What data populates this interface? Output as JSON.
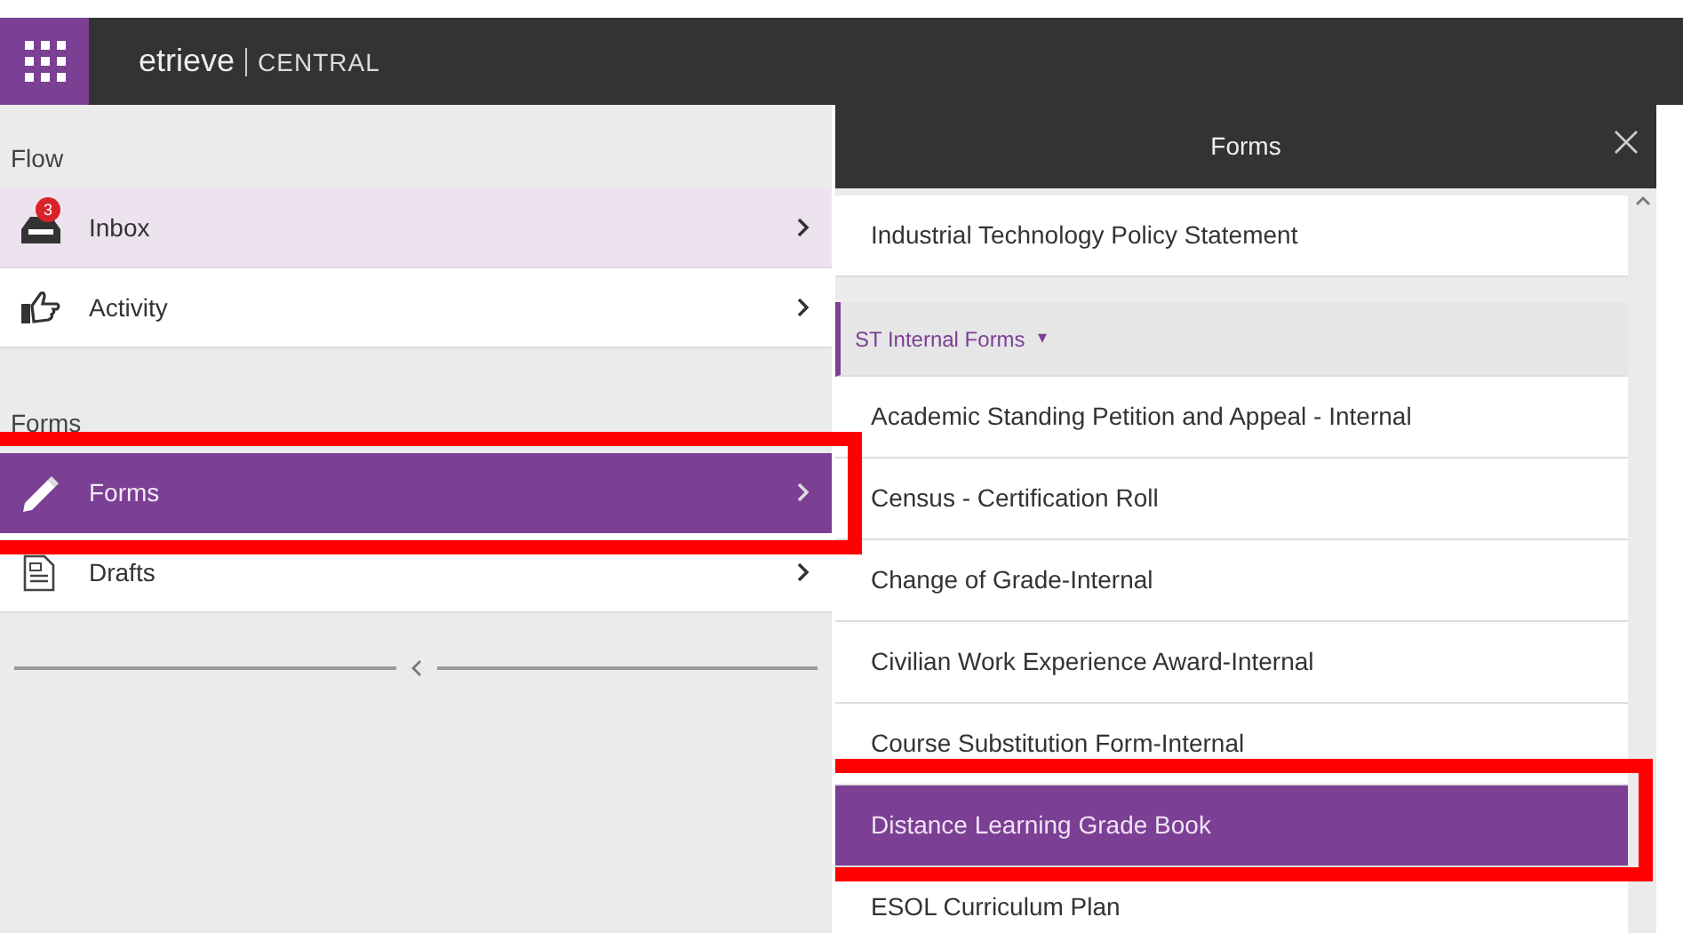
{
  "topbar": {
    "logo_name": "etrieve",
    "product": "CENTRAL"
  },
  "sidebar": {
    "sections": [
      {
        "title": "Flow",
        "items": [
          {
            "label": "Inbox",
            "badge": "3",
            "selected": false,
            "shaded": true,
            "highlighted": false
          },
          {
            "label": "Activity",
            "selected": false,
            "shaded": false,
            "highlighted": false
          }
        ]
      },
      {
        "title": "Forms",
        "items": [
          {
            "label": "Forms",
            "selected": true,
            "shaded": false,
            "highlighted": true
          },
          {
            "label": "Drafts",
            "selected": false,
            "shaded": false,
            "highlighted": false
          }
        ]
      }
    ]
  },
  "forms_panel": {
    "title": "Forms",
    "rows": [
      {
        "kind": "item",
        "label": "Industrial Technology Policy Statement",
        "selected": false,
        "highlighted": false
      },
      {
        "kind": "group",
        "label": "ST Internal Forms",
        "toggle": "▾"
      },
      {
        "kind": "item",
        "label": "Academic Standing Petition and Appeal - Internal",
        "selected": false,
        "highlighted": false
      },
      {
        "kind": "item",
        "label": "Census - Certification Roll",
        "selected": false,
        "highlighted": false
      },
      {
        "kind": "item",
        "label": "Change of Grade-Internal",
        "selected": false,
        "highlighted": false
      },
      {
        "kind": "item",
        "label": "Civilian Work Experience Award-Internal",
        "selected": false,
        "highlighted": false
      },
      {
        "kind": "item",
        "label": "Course Substitution Form-Internal",
        "selected": false,
        "highlighted": false
      },
      {
        "kind": "item",
        "label": "Distance Learning Grade Book",
        "selected": true,
        "highlighted": true
      },
      {
        "kind": "item",
        "label": "ESOL Curriculum Plan",
        "selected": false,
        "highlighted": false
      }
    ]
  }
}
